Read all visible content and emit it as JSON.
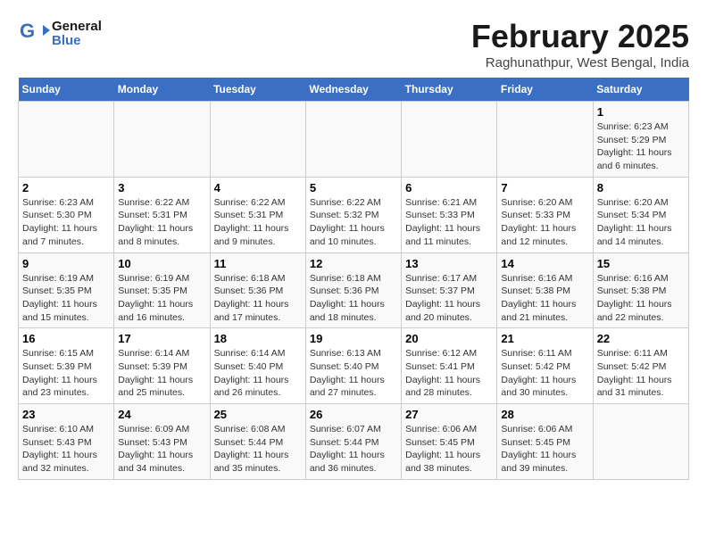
{
  "header": {
    "logo_line1": "General",
    "logo_line2": "Blue",
    "title": "February 2025",
    "subtitle": "Raghunathpur, West Bengal, India"
  },
  "weekdays": [
    "Sunday",
    "Monday",
    "Tuesday",
    "Wednesday",
    "Thursday",
    "Friday",
    "Saturday"
  ],
  "weeks": [
    [
      {
        "day": "",
        "info": ""
      },
      {
        "day": "",
        "info": ""
      },
      {
        "day": "",
        "info": ""
      },
      {
        "day": "",
        "info": ""
      },
      {
        "day": "",
        "info": ""
      },
      {
        "day": "",
        "info": ""
      },
      {
        "day": "1",
        "info": "Sunrise: 6:23 AM\nSunset: 5:29 PM\nDaylight: 11 hours and 6 minutes."
      }
    ],
    [
      {
        "day": "2",
        "info": "Sunrise: 6:23 AM\nSunset: 5:30 PM\nDaylight: 11 hours and 7 minutes."
      },
      {
        "day": "3",
        "info": "Sunrise: 6:22 AM\nSunset: 5:31 PM\nDaylight: 11 hours and 8 minutes."
      },
      {
        "day": "4",
        "info": "Sunrise: 6:22 AM\nSunset: 5:31 PM\nDaylight: 11 hours and 9 minutes."
      },
      {
        "day": "5",
        "info": "Sunrise: 6:22 AM\nSunset: 5:32 PM\nDaylight: 11 hours and 10 minutes."
      },
      {
        "day": "6",
        "info": "Sunrise: 6:21 AM\nSunset: 5:33 PM\nDaylight: 11 hours and 11 minutes."
      },
      {
        "day": "7",
        "info": "Sunrise: 6:20 AM\nSunset: 5:33 PM\nDaylight: 11 hours and 12 minutes."
      },
      {
        "day": "8",
        "info": "Sunrise: 6:20 AM\nSunset: 5:34 PM\nDaylight: 11 hours and 14 minutes."
      }
    ],
    [
      {
        "day": "9",
        "info": "Sunrise: 6:19 AM\nSunset: 5:35 PM\nDaylight: 11 hours and 15 minutes."
      },
      {
        "day": "10",
        "info": "Sunrise: 6:19 AM\nSunset: 5:35 PM\nDaylight: 11 hours and 16 minutes."
      },
      {
        "day": "11",
        "info": "Sunrise: 6:18 AM\nSunset: 5:36 PM\nDaylight: 11 hours and 17 minutes."
      },
      {
        "day": "12",
        "info": "Sunrise: 6:18 AM\nSunset: 5:36 PM\nDaylight: 11 hours and 18 minutes."
      },
      {
        "day": "13",
        "info": "Sunrise: 6:17 AM\nSunset: 5:37 PM\nDaylight: 11 hours and 20 minutes."
      },
      {
        "day": "14",
        "info": "Sunrise: 6:16 AM\nSunset: 5:38 PM\nDaylight: 11 hours and 21 minutes."
      },
      {
        "day": "15",
        "info": "Sunrise: 6:16 AM\nSunset: 5:38 PM\nDaylight: 11 hours and 22 minutes."
      }
    ],
    [
      {
        "day": "16",
        "info": "Sunrise: 6:15 AM\nSunset: 5:39 PM\nDaylight: 11 hours and 23 minutes."
      },
      {
        "day": "17",
        "info": "Sunrise: 6:14 AM\nSunset: 5:39 PM\nDaylight: 11 hours and 25 minutes."
      },
      {
        "day": "18",
        "info": "Sunrise: 6:14 AM\nSunset: 5:40 PM\nDaylight: 11 hours and 26 minutes."
      },
      {
        "day": "19",
        "info": "Sunrise: 6:13 AM\nSunset: 5:40 PM\nDaylight: 11 hours and 27 minutes."
      },
      {
        "day": "20",
        "info": "Sunrise: 6:12 AM\nSunset: 5:41 PM\nDaylight: 11 hours and 28 minutes."
      },
      {
        "day": "21",
        "info": "Sunrise: 6:11 AM\nSunset: 5:42 PM\nDaylight: 11 hours and 30 minutes."
      },
      {
        "day": "22",
        "info": "Sunrise: 6:11 AM\nSunset: 5:42 PM\nDaylight: 11 hours and 31 minutes."
      }
    ],
    [
      {
        "day": "23",
        "info": "Sunrise: 6:10 AM\nSunset: 5:43 PM\nDaylight: 11 hours and 32 minutes."
      },
      {
        "day": "24",
        "info": "Sunrise: 6:09 AM\nSunset: 5:43 PM\nDaylight: 11 hours and 34 minutes."
      },
      {
        "day": "25",
        "info": "Sunrise: 6:08 AM\nSunset: 5:44 PM\nDaylight: 11 hours and 35 minutes."
      },
      {
        "day": "26",
        "info": "Sunrise: 6:07 AM\nSunset: 5:44 PM\nDaylight: 11 hours and 36 minutes."
      },
      {
        "day": "27",
        "info": "Sunrise: 6:06 AM\nSunset: 5:45 PM\nDaylight: 11 hours and 38 minutes."
      },
      {
        "day": "28",
        "info": "Sunrise: 6:06 AM\nSunset: 5:45 PM\nDaylight: 11 hours and 39 minutes."
      },
      {
        "day": "",
        "info": ""
      }
    ]
  ]
}
